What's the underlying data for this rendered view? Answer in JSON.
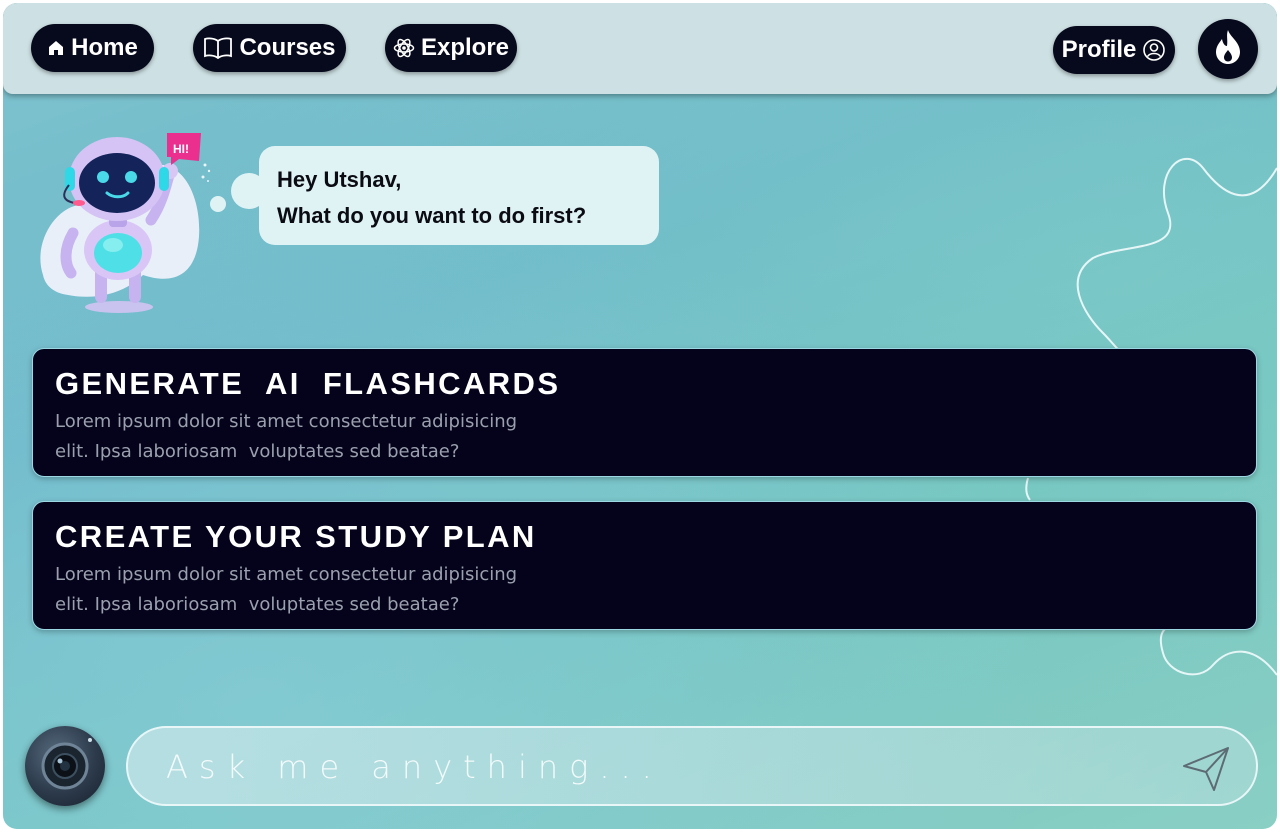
{
  "nav": {
    "home_label": "Home",
    "courses_label": "Courses",
    "explore_label": "Explore",
    "profile_label": "Profile"
  },
  "assistant": {
    "greeting_line1": "Hey Utshav,",
    "greeting_line2": "What do you want to do first?",
    "badge_text": "HI!"
  },
  "cards": [
    {
      "title": "GENERATE  AI  FLASHCARDS",
      "description": "Lorem ipsum dolor sit amet consectetur adipisicing\nelit. Ipsa laboriosam  voluptates sed beatae?"
    },
    {
      "title": "CREATE YOUR STUDY PLAN",
      "description": "Lorem ipsum dolor sit amet consectetur adipisicing\nelit. Ipsa laboriosam  voluptates sed beatae?"
    }
  ],
  "chat": {
    "placeholder": "Ask me anything..."
  },
  "icons": {
    "home": "home-icon",
    "courses": "book-icon",
    "explore": "atom-icon",
    "profile": "user-circle-icon",
    "streak": "flame-icon",
    "camera": "camera-icon",
    "send": "send-icon"
  },
  "colors": {
    "pill_bg": "#070a1c",
    "card_bg": "#05031b",
    "bubble_bg": "#dff3f5",
    "nav_bg": "#cde0e3"
  }
}
